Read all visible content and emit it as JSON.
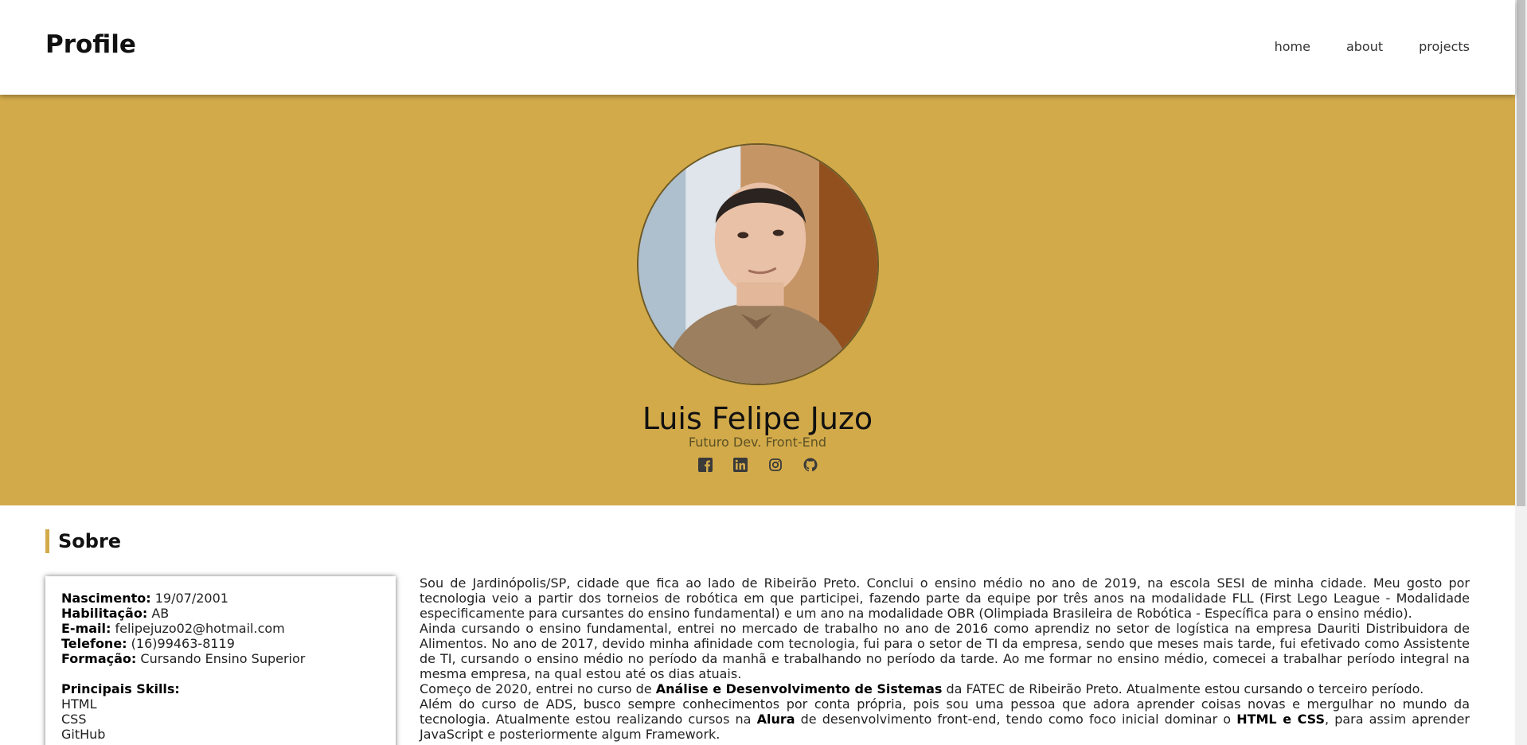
{
  "header": {
    "brand": "Profile",
    "nav": [
      "home",
      "about",
      "projects"
    ]
  },
  "hero": {
    "name": "Luis Felipe Juzo",
    "role": "Futuro Dev. Front-End",
    "socials": [
      "facebook-icon",
      "linkedin-icon",
      "instagram-icon",
      "github-icon"
    ],
    "background_color": "#d2aa4a"
  },
  "sobre": {
    "title": "Sobre",
    "info": [
      {
        "label": "Nascimento:",
        "value": "19/07/2001"
      },
      {
        "label": "Habilitação:",
        "value": "AB"
      },
      {
        "label": "E-mail:",
        "value": "felipejuzo02@hotmail.com"
      },
      {
        "label": "Telefone:",
        "value": "(16)99463-8119"
      },
      {
        "label": "Formação:",
        "value": "Cursando Ensino Superior"
      }
    ],
    "skills_title": "Principais Skills:",
    "skills": [
      "HTML",
      "CSS",
      "GitHub"
    ],
    "bio": {
      "p1": "Sou de Jardinópolis/SP, cidade que fica ao lado de Ribeirão Preto. Conclui o ensino médio no ano de 2019, na escola SESI de minha cidade. Meu gosto por tecnologia veio a partir dos torneios de robótica em que participei, fazendo parte da equipe por três anos na modalidade FLL (First Lego League - Modalidade especificamente para cursantes do ensino fundamental) e um ano na modalidade OBR (Olimpiada Brasileira de Robótica - Específica para o ensino médio).",
      "p2": "Ainda cursando o ensino fundamental, entrei no mercado de trabalho no ano de 2016 como aprendiz no setor de logística na empresa Dauriti Distribuidora de Alimentos. No ano de 2017, devido minha afinidade com tecnologia, fui para o setor de TI da empresa, sendo que meses mais tarde, fui efetivado como Assistente de TI, cursando o ensino médio no período da manhã e trabalhando no período da tarde. Ao me formar no ensino médio, comecei a trabalhar período integral na mesma empresa, na qual estou até os dias atuais.",
      "p3_pre": "Começo de 2020, entrei no curso de ",
      "p3_bold": "Análise e Desenvolvimento de Sistemas",
      "p3_post": " da FATEC de Ribeirão Preto. Atualmente estou cursando o terceiro período.",
      "p4_pre": "Além do curso de ADS, busco sempre conhecimentos por conta própria, pois sou uma pessoa que adora aprender coisas novas e mergulhar no mundo da tecnologia. Atualmente estou realizando cursos na ",
      "p4_bold1": "Alura",
      "p4_mid": " de desenvolvimento front-end, tendo como foco inicial dominar o ",
      "p4_bold2": "HTML e CSS",
      "p4_post": ", para assim aprender JavaScript e posteriormente algum Framework."
    }
  }
}
